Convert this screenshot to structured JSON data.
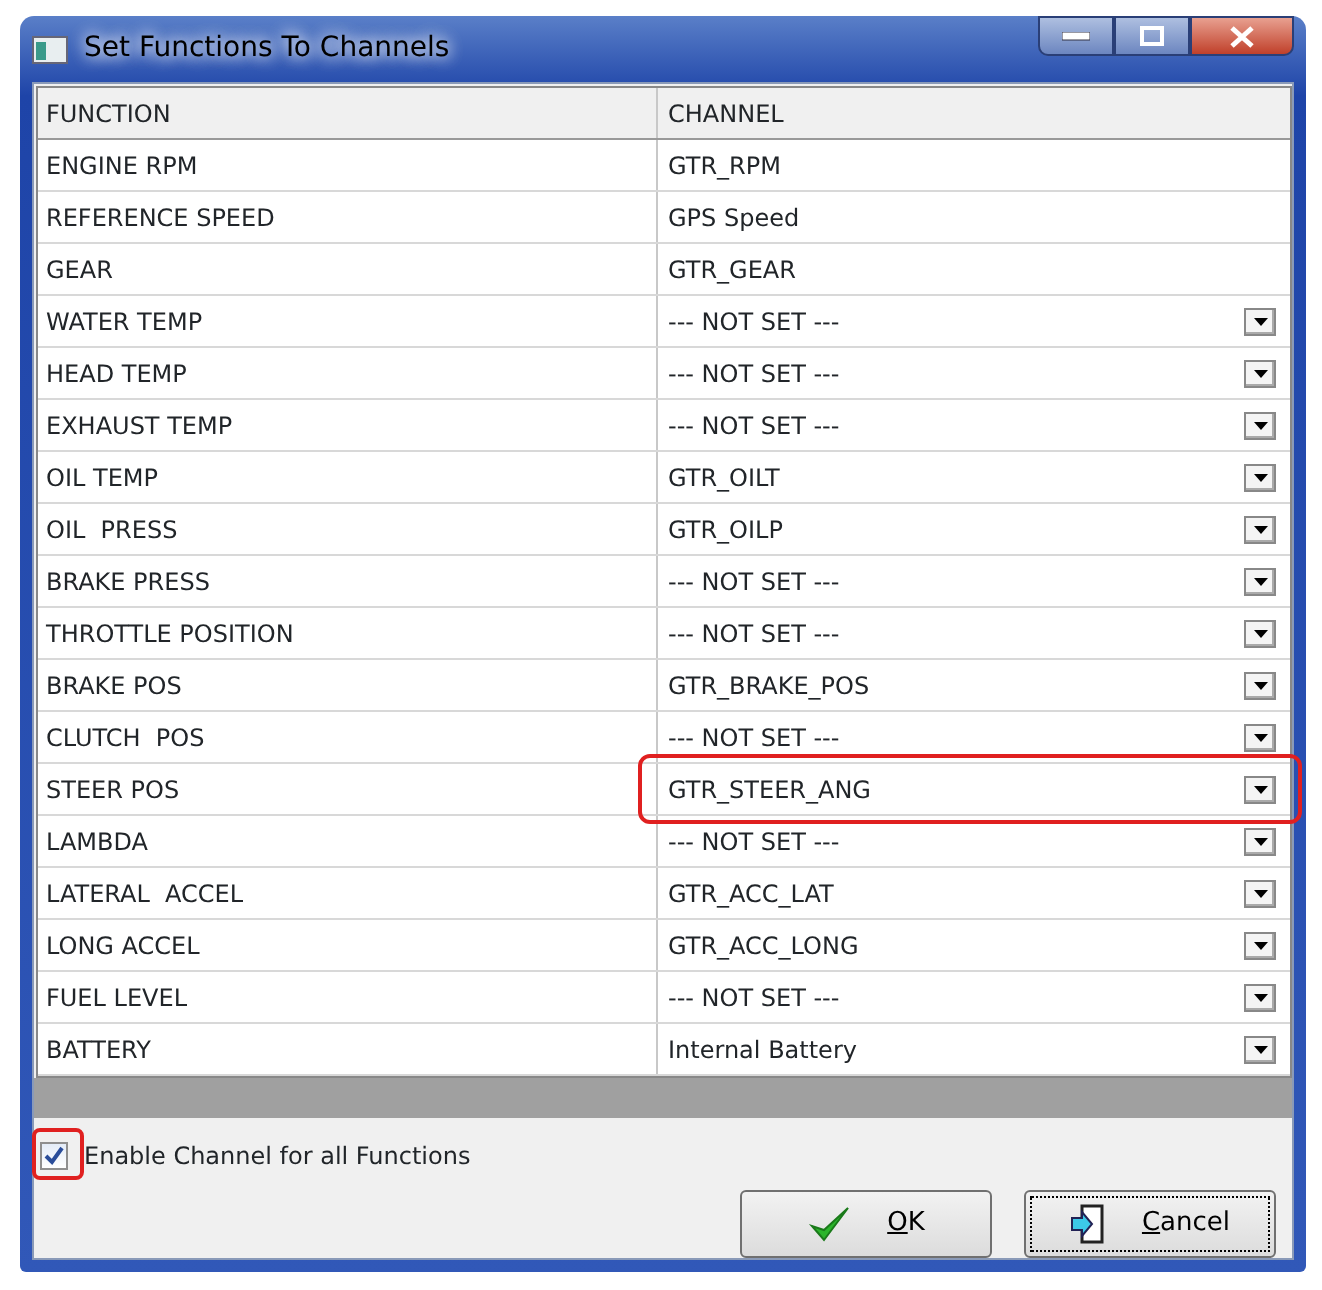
{
  "window": {
    "title": "Set Functions To Channels"
  },
  "table": {
    "columns": [
      "FUNCTION",
      "CHANNEL"
    ],
    "rows": [
      {
        "function": "ENGINE RPM",
        "channel": "GTR_RPM",
        "kind": "text",
        "highlighted": false
      },
      {
        "function": "REFERENCE SPEED",
        "channel": "GPS Speed",
        "kind": "text",
        "highlighted": false
      },
      {
        "function": "GEAR",
        "channel": "GTR_GEAR",
        "kind": "text",
        "highlighted": false
      },
      {
        "function": "WATER TEMP",
        "channel": "--- NOT SET ---",
        "kind": "dropdown",
        "highlighted": false
      },
      {
        "function": "HEAD TEMP",
        "channel": "--- NOT SET ---",
        "kind": "dropdown",
        "highlighted": false
      },
      {
        "function": "EXHAUST TEMP",
        "channel": "--- NOT SET ---",
        "kind": "dropdown",
        "highlighted": false
      },
      {
        "function": "OIL TEMP",
        "channel": "GTR_OILT",
        "kind": "dropdown",
        "highlighted": false
      },
      {
        "function": "OIL  PRESS",
        "channel": "GTR_OILP",
        "kind": "dropdown",
        "highlighted": false
      },
      {
        "function": "BRAKE PRESS",
        "channel": "--- NOT SET ---",
        "kind": "dropdown",
        "highlighted": false
      },
      {
        "function": "THROTTLE POSITION",
        "channel": "--- NOT SET ---",
        "kind": "dropdown",
        "highlighted": false
      },
      {
        "function": "BRAKE POS",
        "channel": "GTR_BRAKE_POS",
        "kind": "dropdown",
        "highlighted": false
      },
      {
        "function": "CLUTCH  POS",
        "channel": "--- NOT SET ---",
        "kind": "dropdown",
        "highlighted": false
      },
      {
        "function": "STEER POS",
        "channel": "GTR_STEER_ANG",
        "kind": "dropdown",
        "highlighted": true
      },
      {
        "function": "LAMBDA",
        "channel": "--- NOT SET ---",
        "kind": "dropdown",
        "highlighted": false
      },
      {
        "function": "LATERAL  ACCEL",
        "channel": "GTR_ACC_LAT",
        "kind": "dropdown",
        "highlighted": false
      },
      {
        "function": "LONG ACCEL",
        "channel": "GTR_ACC_LONG",
        "kind": "dropdown",
        "highlighted": false
      },
      {
        "function": "FUEL LEVEL",
        "channel": "--- NOT SET ---",
        "kind": "dropdown",
        "highlighted": false
      },
      {
        "function": "BATTERY",
        "channel": "Internal Battery",
        "kind": "dropdown",
        "highlighted": false
      }
    ]
  },
  "checkbox": {
    "label": "Enable Channel for all Functions",
    "checked": true,
    "highlighted": true
  },
  "buttons": [
    {
      "label": "OK",
      "kind": "ok",
      "mnemonic": true,
      "focused": false
    },
    {
      "label": "Cancel",
      "kind": "cancel",
      "mnemonic": true,
      "focused": true
    }
  ]
}
